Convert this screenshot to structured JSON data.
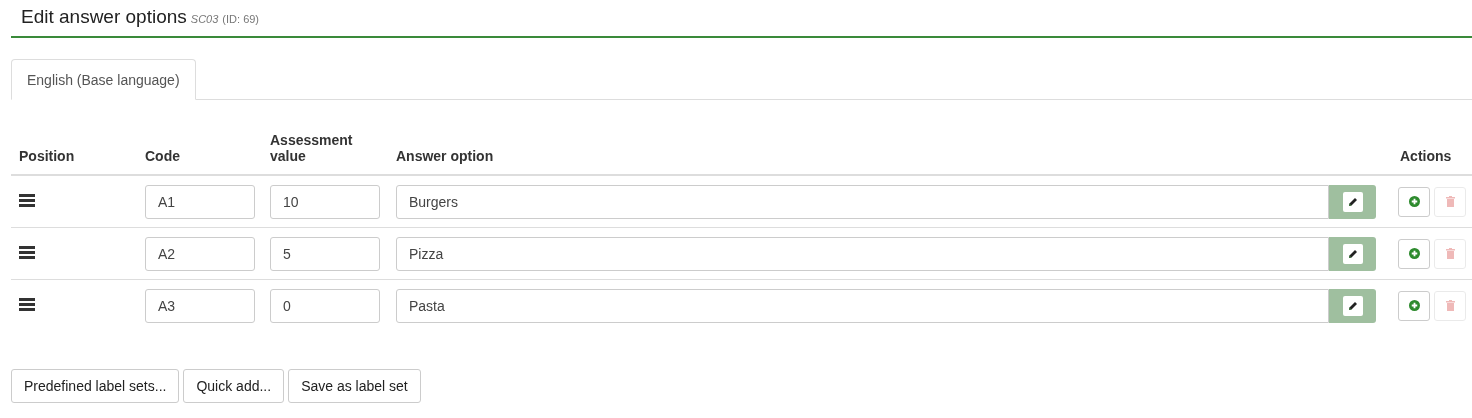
{
  "header": {
    "title": "Edit answer options",
    "code": "SC03",
    "id": "(ID: 69)"
  },
  "tabs": [
    {
      "label": "English (Base language)",
      "selected": true
    }
  ],
  "table": {
    "columns": [
      "Position",
      "Code",
      "Assessment value",
      "Answer option",
      "Actions"
    ],
    "rows": [
      {
        "code": "A1",
        "assessment": "10",
        "answer": "Burgers",
        "delete_disabled": true
      },
      {
        "code": "A2",
        "assessment": "5",
        "answer": "Pizza",
        "delete_disabled": true
      },
      {
        "code": "A3",
        "assessment": "0",
        "answer": "Pasta",
        "delete_disabled": true
      }
    ]
  },
  "buttons": [
    "Predefined label sets...",
    "Quick add...",
    "Save as label set"
  ]
}
